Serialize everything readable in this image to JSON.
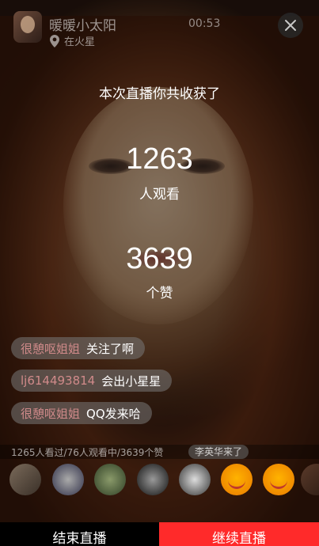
{
  "header": {
    "host_name": "暖暖小太阳",
    "location": "在火星",
    "timer": "00:53"
  },
  "summary": {
    "title": "本次直播你共收获了",
    "viewers_count": "1263",
    "viewers_label": "人观看",
    "likes_count": "3639",
    "likes_label": "个赞"
  },
  "comments": [
    {
      "user": "很憩呕姐姐",
      "text": "关注了啊"
    },
    {
      "user": "lj614493814",
      "text": "会出小星星"
    },
    {
      "user": "很憩呕姐姐",
      "text": "QQ发来哈"
    }
  ],
  "stats": {
    "text": "1265人看过/76人观看中/3639个赞",
    "notice": "李英华来了"
  },
  "viewer_avatars": [
    "avatar-1",
    "avatar-2",
    "avatar-3",
    "avatar-4",
    "avatar-5",
    "emoji-avatar",
    "emoji-avatar",
    "avatar-8"
  ],
  "buttons": {
    "end": "结束直播",
    "continue": "继续直播"
  },
  "colors": {
    "continue_button": "#ff2a2a",
    "end_button": "#000000",
    "username": "#d08a8a"
  }
}
